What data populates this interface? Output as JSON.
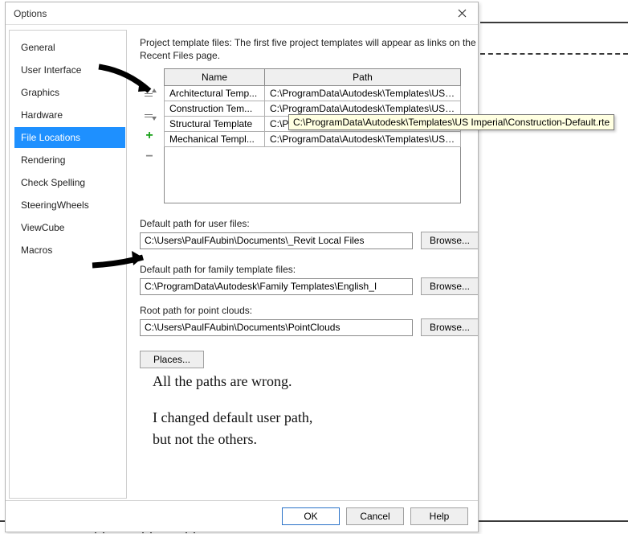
{
  "dialog": {
    "title": "Options",
    "intro": "Project template files:  The first five project templates will appear as links on the Recent Files page.",
    "sidebar": {
      "items": [
        {
          "label": "General"
        },
        {
          "label": "User Interface"
        },
        {
          "label": "Graphics"
        },
        {
          "label": "Hardware"
        },
        {
          "label": "File Locations",
          "active": true
        },
        {
          "label": "Rendering"
        },
        {
          "label": "Check Spelling"
        },
        {
          "label": "SteeringWheels"
        },
        {
          "label": "ViewCube"
        },
        {
          "label": "Macros"
        }
      ]
    },
    "templateTable": {
      "headers": {
        "name": "Name",
        "path": "Path"
      },
      "rows": [
        {
          "name": "Architectural Temp...",
          "path": "C:\\ProgramData\\Autodesk\\Templates\\US I..."
        },
        {
          "name": "Construction Tem...",
          "path": "C:\\ProgramData\\Autodesk\\Templates\\US I..."
        },
        {
          "name": "Structural Template",
          "path": "C:\\Pro"
        },
        {
          "name": "Mechanical Templ...",
          "path": "C:\\ProgramData\\Autodesk\\Templates\\US I..."
        }
      ]
    },
    "tooltip": "C:\\ProgramData\\Autodesk\\Templates\\US Imperial\\Construction-Default.rte",
    "paths": {
      "userFiles": {
        "label": "Default path for user files:",
        "value": "C:\\Users\\PaulFAubin\\Documents\\_Revit Local Files",
        "browse": "Browse..."
      },
      "familyTemplates": {
        "label": "Default path for family template files:",
        "value": "C:\\ProgramData\\Autodesk\\Family Templates\\English_I",
        "browse": "Browse..."
      },
      "pointClouds": {
        "label": "Root path for point clouds:",
        "value": "C:\\Users\\PaulFAubin\\Documents\\PointClouds",
        "browse": "Browse..."
      }
    },
    "placesButton": "Places...",
    "footer": {
      "ok": "OK",
      "cancel": "Cancel",
      "help": "Help"
    },
    "annotation": {
      "line1": "All the paths are wrong.",
      "line2": "I changed default user path,",
      "line3": "but not the others."
    }
  }
}
